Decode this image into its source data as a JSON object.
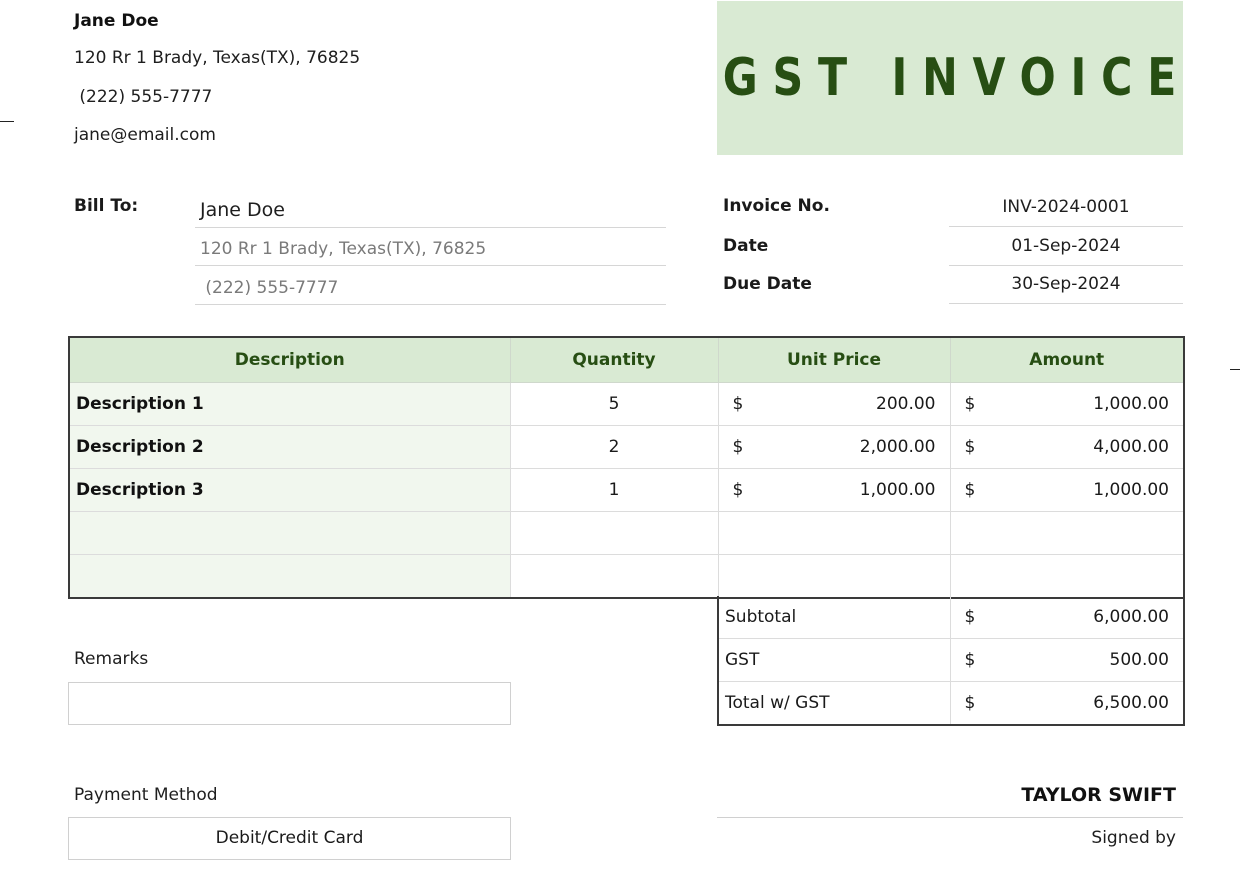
{
  "seller": {
    "name": "Jane Doe",
    "address": "120 Rr 1 Brady, Texas(TX), 76825",
    "phone": " (222) 555-7777",
    "email": "jane@email.com"
  },
  "title": "GST INVOICE",
  "bill_to": {
    "label": "Bill To:",
    "name": "Jane Doe",
    "address": "120 Rr 1 Brady, Texas(TX), 76825",
    "phone": " (222) 555-7777"
  },
  "invoice_meta": {
    "number_label": "Invoice No.",
    "number": "INV-2024-0001",
    "date_label": "Date",
    "date": "01-Sep-2024",
    "due_label": "Due Date",
    "due": "30-Sep-2024"
  },
  "items_table": {
    "headers": [
      "Description",
      "Quantity",
      "Unit Price",
      "Amount"
    ],
    "currency": "$",
    "rows": [
      {
        "description": "Description 1",
        "quantity": "5",
        "unit_price": "200.00",
        "amount": "1,000.00"
      },
      {
        "description": "Description 2",
        "quantity": "2",
        "unit_price": "2,000.00",
        "amount": "4,000.00"
      },
      {
        "description": "Description 3",
        "quantity": "1",
        "unit_price": "1,000.00",
        "amount": "1,000.00"
      },
      {
        "description": "",
        "quantity": "",
        "unit_price": "",
        "amount": ""
      },
      {
        "description": "",
        "quantity": "",
        "unit_price": "",
        "amount": ""
      }
    ]
  },
  "totals": {
    "subtotal_label": "Subtotal",
    "subtotal": "6,000.00",
    "gst_label": "GST",
    "gst": "500.00",
    "total_label": "Total w/ GST",
    "total": "6,500.00"
  },
  "remarks": {
    "label": "Remarks",
    "value": ""
  },
  "payment": {
    "label": "Payment Method",
    "value": "Debit/Credit Card"
  },
  "signature": {
    "name": "TAYLOR SWIFT",
    "caption": "Signed by"
  },
  "colors": {
    "accent_bg": "#d9ead3",
    "accent_text": "#274e13",
    "row_tint": "#f1f7ee"
  }
}
